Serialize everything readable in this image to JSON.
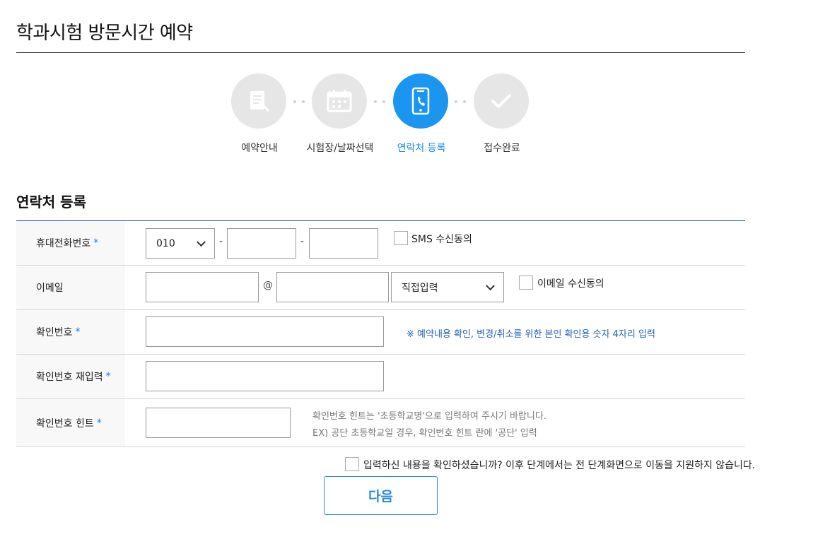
{
  "header": {
    "title": "학과시험 방문시간 예약"
  },
  "steps": [
    {
      "label": "예약안내",
      "icon": "document-edit-icon",
      "active": false
    },
    {
      "label": "시험장/날짜선택",
      "icon": "calendar-icon",
      "active": false
    },
    {
      "label": "연락처 등록",
      "icon": "phone-icon",
      "active": true
    },
    {
      "label": "접수완료",
      "icon": "check-icon",
      "active": false
    }
  ],
  "section": {
    "title": "연락처 등록"
  },
  "form": {
    "phone": {
      "label": "휴대전화번호",
      "required_mark": "*",
      "prefix_value": "010",
      "dash": "-",
      "middle_value": "",
      "last_value": "",
      "sms_consent_label": "SMS 수신동의"
    },
    "email": {
      "label": "이메일",
      "local_value": "",
      "at": "@",
      "domain_value": "",
      "domain_select_value": "직접입력",
      "email_consent_label": "이메일 수신동의"
    },
    "pin": {
      "label": "확인번호",
      "required_mark": "*",
      "value": "",
      "note": "※ 예약내용 확인, 변경/취소를 위한 본인 확인용 숫자 4자리 입력"
    },
    "pin_confirm": {
      "label": "확인번호 재입력",
      "required_mark": "*",
      "value": ""
    },
    "pin_hint": {
      "label": "확인번호 힌트",
      "required_mark": "*",
      "value": "",
      "note_line1": "확인번호 힌트는 '초등학교명'으로 입력하여 주시기 바랍니다.",
      "note_line2": "EX) 공단 초등학교일 경우, 확인번호 힌트 란에 '공단' 입력"
    }
  },
  "confirm": {
    "label": "입력하신 내용을 확인하셨습니까? 이후 단계에서는 전 단계화면으로 이동을 지원하지 않습니다."
  },
  "actions": {
    "next_label": "다음"
  },
  "colors": {
    "accent": "#1a96f0",
    "required": "#1a7ae0",
    "note_blue": "#1f5fb8",
    "rule": "#1c5a9e"
  }
}
